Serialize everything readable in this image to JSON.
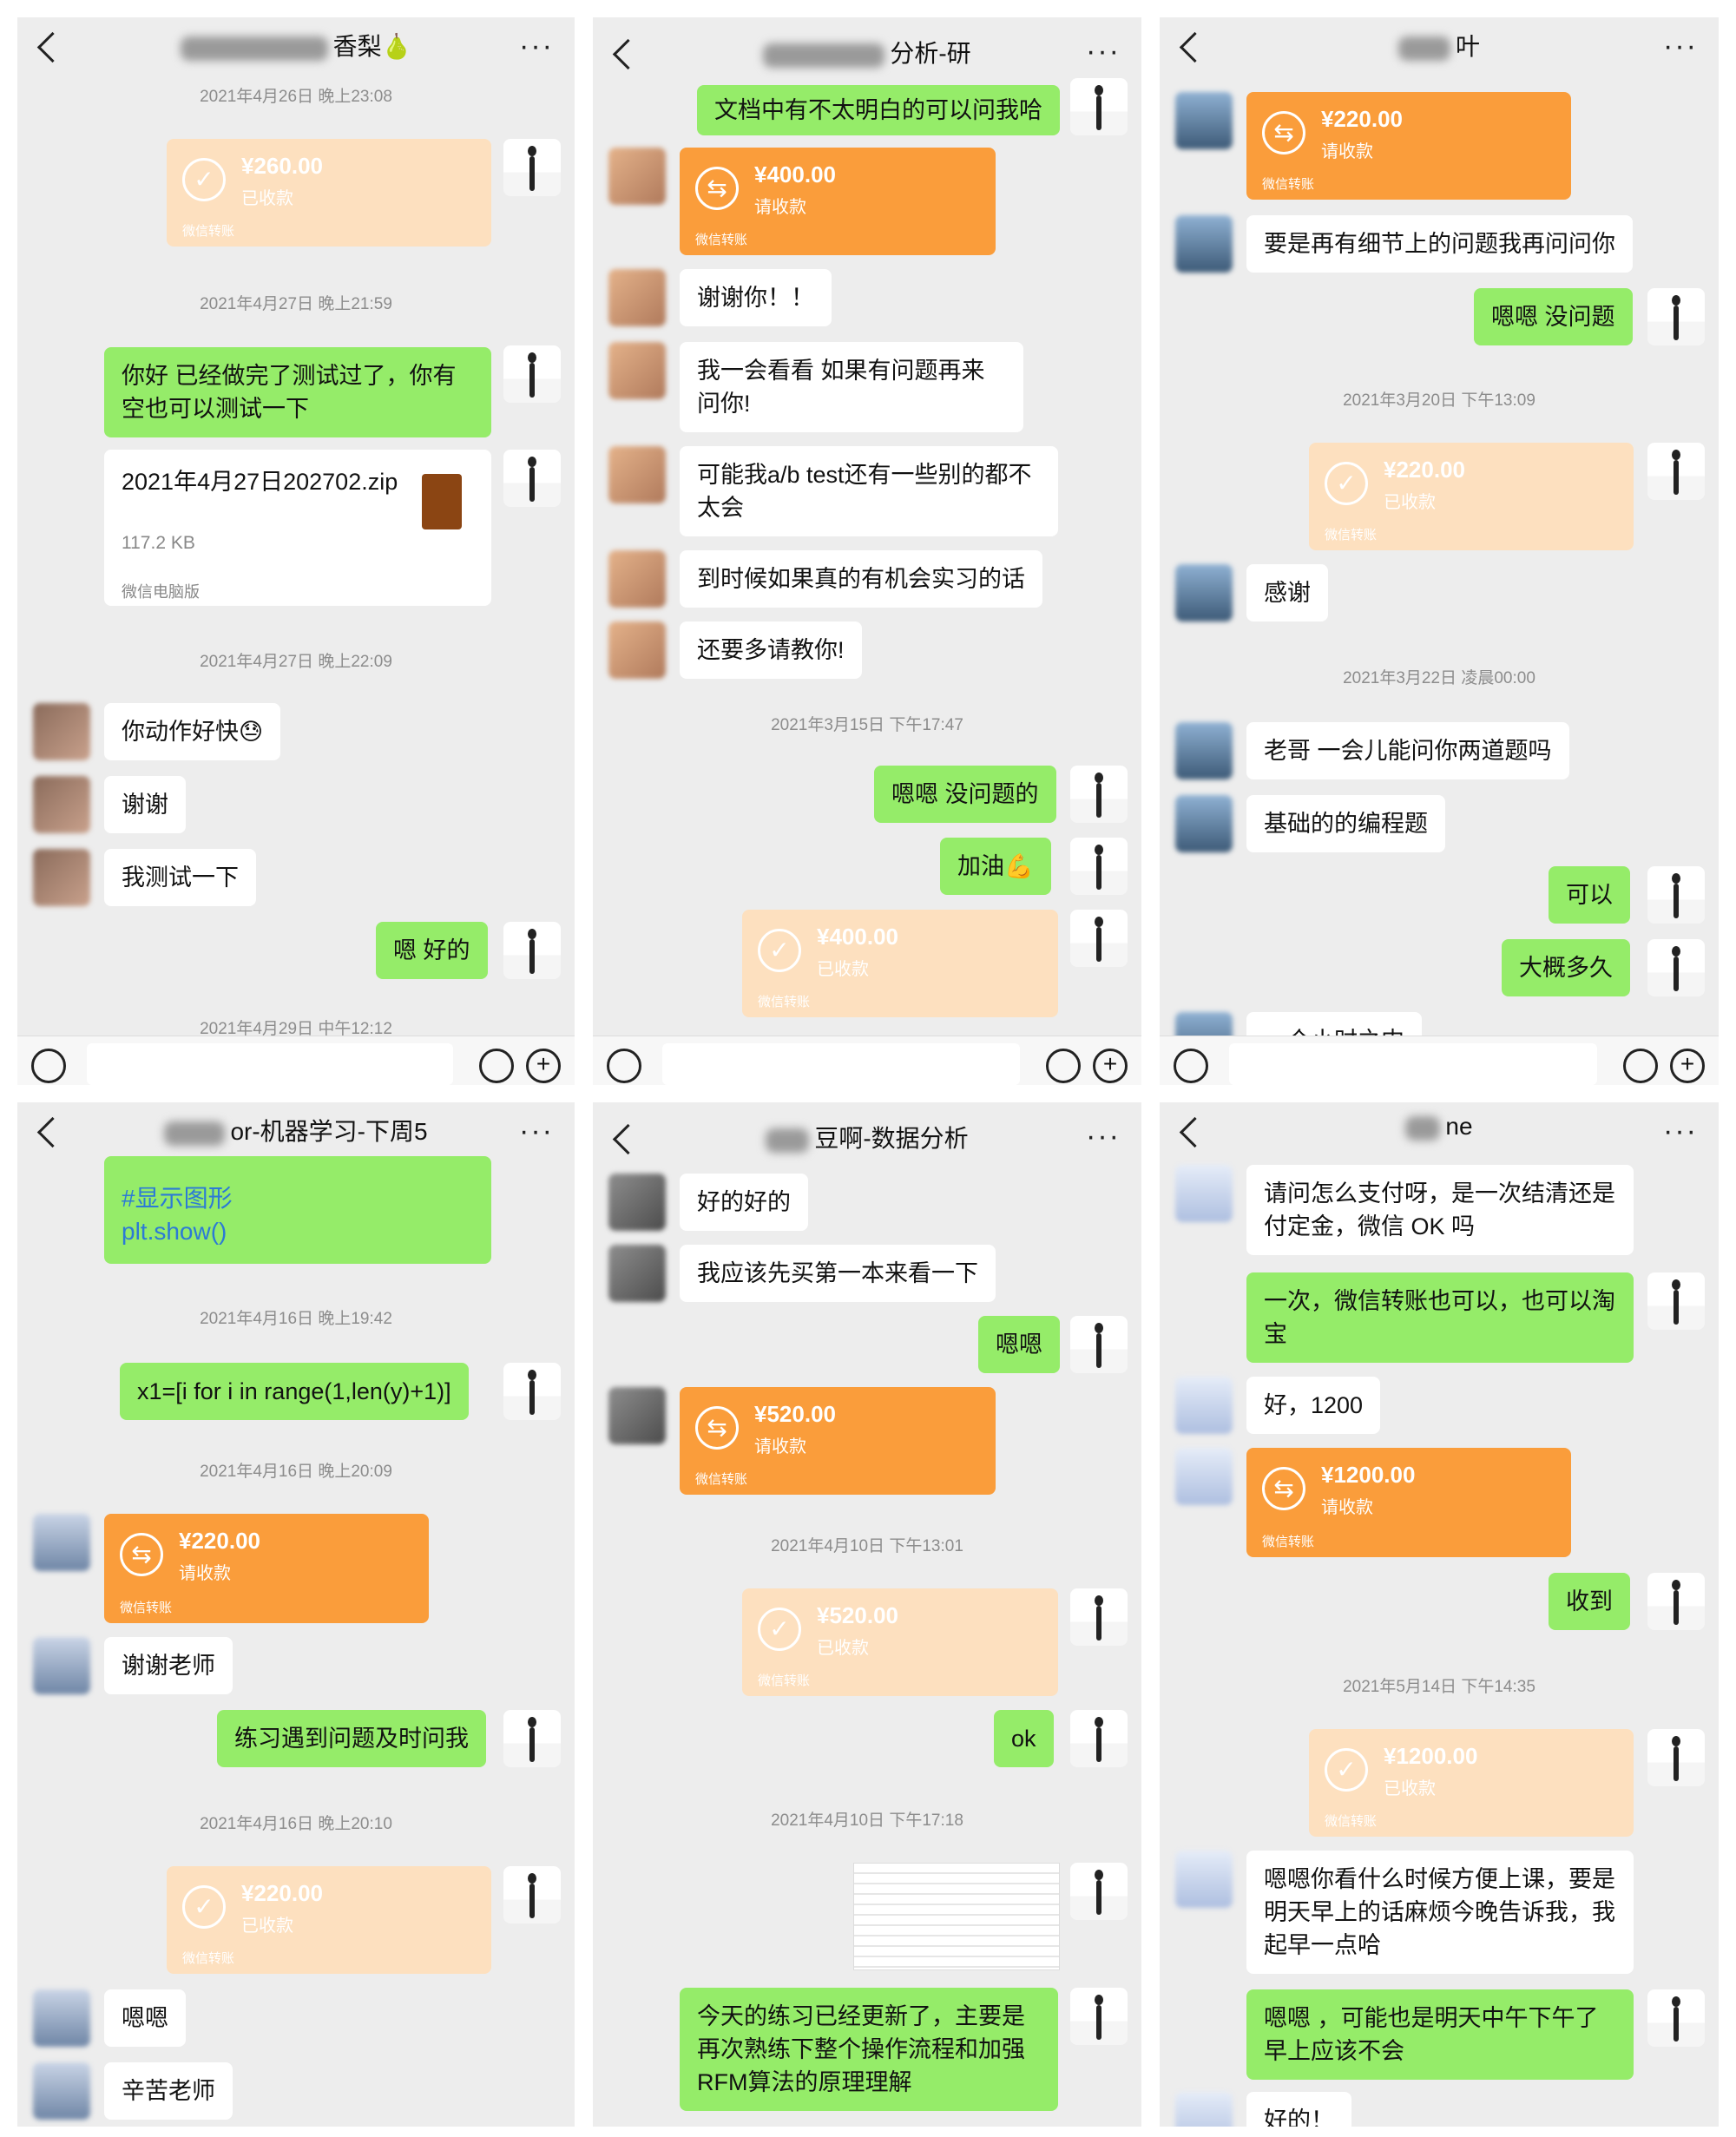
{
  "colors": {
    "panel_bg": "#ededed",
    "sent": "#95ec69",
    "received": "#ffffff",
    "transfer": "#fa9d3b",
    "transfer_done": "#fde0bf"
  },
  "icons": {
    "back": "chevron-left-icon",
    "more": "ellipsis-icon",
    "voice": "voice-icon",
    "emoji": "emoji-icon",
    "plus": "plus-icon",
    "transfer": "transfer-arrows-icon",
    "received": "check-circle-icon"
  },
  "transfer_label": "微信转账",
  "p1": {
    "title": "香梨🍐",
    "ts": [
      "2021年4月26日 晚上23:08",
      "2021年4月27日 晚上21:59",
      "2021年4月27日 晚上22:09",
      "2021年4月29日 中午12:12"
    ],
    "t1": {
      "amount": "¥260.00",
      "status": "已收款"
    },
    "m1": "你好 已经做完了测试过了，你有空也可以测试一下",
    "file": {
      "name": "2021年4月27日202702.zip",
      "size": "117.2 KB",
      "source": "微信电脑版"
    },
    "m2": "你动作好快😓",
    "m3": "谢谢",
    "m4": "我测试一下",
    "m5": "嗯 好的"
  },
  "p2": {
    "title": "分析-研",
    "m0": "文档中有不太明白的可以问我哈",
    "t1": {
      "amount": "¥400.00",
      "status": "请收款"
    },
    "m1": "谢谢你！！",
    "m2": "我一会看看 如果有问题再来问你!",
    "m3": "可能我a/b test还有一些别的都不太会",
    "m4": "到时候如果真的有机会实习的话",
    "m5": "还要多请教你!",
    "ts": [
      "2021年3月15日 下午17:47"
    ],
    "m6": "嗯嗯 没问题的",
    "m7": "加油💪",
    "t2": {
      "amount": "¥400.00",
      "status": "已收款"
    }
  },
  "p3": {
    "title": "叶",
    "t1": {
      "amount": "¥220.00",
      "status": "请收款"
    },
    "m1": "要是再有细节上的问题我再问问你",
    "m2": "嗯嗯 没问题",
    "ts": [
      "2021年3月20日 下午13:09",
      "2021年3月22日 凌晨00:00"
    ],
    "t2": {
      "amount": "¥220.00",
      "status": "已收款"
    },
    "m3": "感谢",
    "m4": "老哥 一会儿能问你两道题吗",
    "m5": "基础的的编程题",
    "m6": "可以",
    "m7": "大概多久",
    "m8": "一个小时之内"
  },
  "p4": {
    "title": "or-机器学习-下周5",
    "code1": "#显示图形",
    "code2": "plt.show()",
    "ts": [
      "2021年4月16日 晚上19:42",
      "2021年4月16日 晚上20:09",
      "2021年4月16日 晚上20:10"
    ],
    "m1": "x1=[i for i in range(1,len(y)+1)]",
    "t1": {
      "amount": "¥220.00",
      "status": "请收款"
    },
    "m2": "谢谢老师",
    "m3": "练习遇到问题及时问我",
    "t2": {
      "amount": "¥220.00",
      "status": "已收款"
    },
    "m4": "嗯嗯",
    "m5": "辛苦老师"
  },
  "p5": {
    "title": "豆啊-数据分析",
    "m1": "好的好的",
    "m2": "我应该先买第一本来看一下",
    "m3": "嗯嗯",
    "t1": {
      "amount": "¥520.00",
      "status": "请收款"
    },
    "ts": [
      "2021年4月10日 下午13:01",
      "2021年4月10日 下午17:18"
    ],
    "t2": {
      "amount": "¥520.00",
      "status": "已收款"
    },
    "m4": "ok",
    "m5": "今天的练习已经更新了，主要是再次熟练下整个操作流程和加强RFM算法的原理理解"
  },
  "p6": {
    "title": "ne",
    "m1": "请问怎么支付呀，是一次结清还是付定金，微信 OK 吗",
    "m2": "一次，微信转账也可以，也可以淘宝",
    "m3": "好，1200",
    "t1": {
      "amount": "¥1200.00",
      "status": "请收款"
    },
    "m4": "收到",
    "ts": [
      "2021年5月14日 下午14:35"
    ],
    "t2": {
      "amount": "¥1200.00",
      "status": "已收款"
    },
    "m5": "嗯嗯你看什么时候方便上课，要是明天早上的话麻烦今晚告诉我，我起早一点哈",
    "m6": "嗯嗯 ，可能也是明天中午下午了早上应该不会",
    "m7": "好的！"
  }
}
